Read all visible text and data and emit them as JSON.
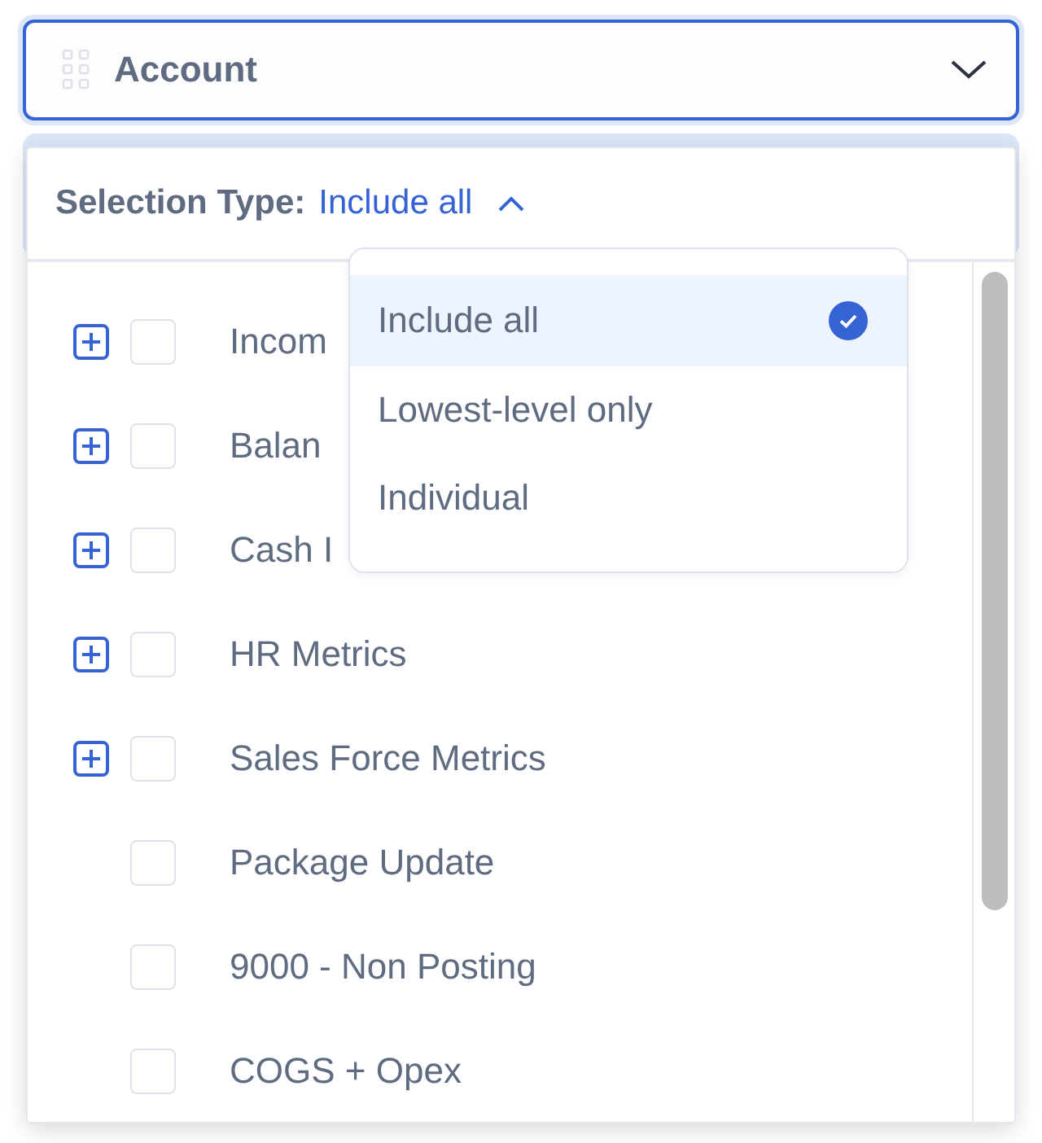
{
  "field": {
    "label": "Account",
    "expanded": true
  },
  "selection_type": {
    "label": "Selection Type:",
    "value": "Include all",
    "expanded": true
  },
  "options": [
    {
      "label": "Include all",
      "selected": true
    },
    {
      "label": "Lowest-level only",
      "selected": false
    },
    {
      "label": "Individual",
      "selected": false
    }
  ],
  "rows": [
    {
      "label": "Incom",
      "expandable": true,
      "checked": false
    },
    {
      "label": "Balan",
      "expandable": true,
      "checked": false
    },
    {
      "label": "Cash I",
      "expandable": true,
      "checked": false
    },
    {
      "label": "HR Metrics",
      "expandable": true,
      "checked": false
    },
    {
      "label": "Sales Force Metrics",
      "expandable": true,
      "checked": false
    },
    {
      "label": "Package Update",
      "expandable": false,
      "checked": false
    },
    {
      "label": "9000 - Non Posting",
      "expandable": false,
      "checked": false
    },
    {
      "label": "COGS + Opex",
      "expandable": false,
      "checked": false
    }
  ]
}
